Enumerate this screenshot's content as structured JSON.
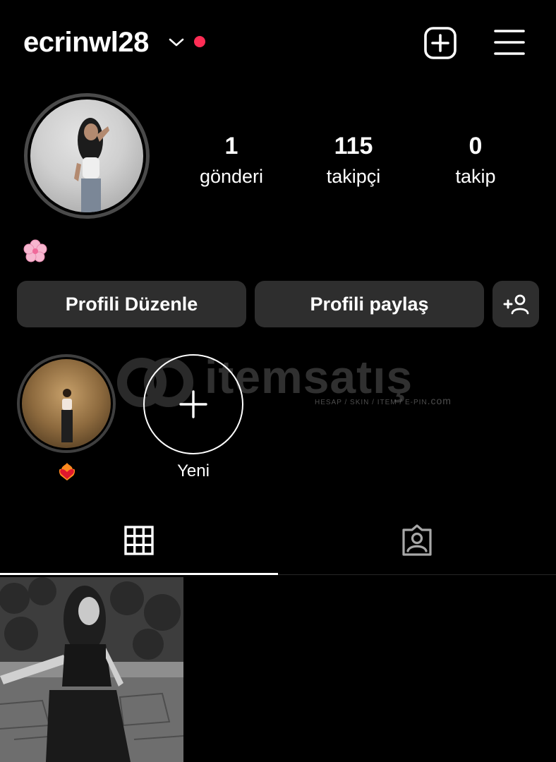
{
  "header": {
    "username": "ecrinwl28",
    "icons": [
      "chevron-down-icon",
      "notification-dot",
      "create-plus-icon",
      "hamburger-menu-icon"
    ],
    "notification_color": "#ff2d55"
  },
  "profile": {
    "stats": [
      {
        "value": "1",
        "label": "gönderi"
      },
      {
        "value": "115",
        "label": "takipçi"
      },
      {
        "value": "0",
        "label": "takip"
      }
    ],
    "bio_icon": "cherry-blossom-emoji"
  },
  "buttons": {
    "edit_profile": "Profili Düzenle",
    "share_profile": "Profili paylaş",
    "add_person_icon": "add-person-icon"
  },
  "highlights": {
    "items": [
      {
        "label_icon": "heart-on-fire-emoji"
      }
    ],
    "new_label": "Yeni"
  },
  "watermark": {
    "text": "itemsatış",
    "subtext": "HESAP / SKIN / ITEM / E-PIN",
    "suffix": ".com"
  },
  "tabs": {
    "active": "grid",
    "items": [
      "grid-icon",
      "tagged-icon"
    ]
  },
  "colors": {
    "background": "#000000",
    "button_bg": "#2e2e2e",
    "text": "#ffffff"
  }
}
